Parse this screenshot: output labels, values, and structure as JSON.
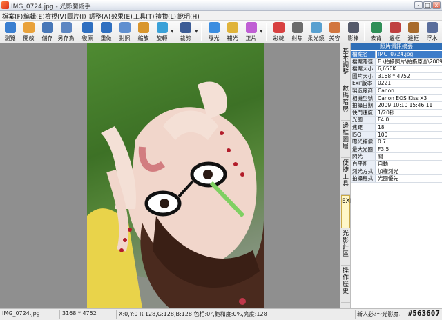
{
  "window": {
    "title": "IMG_0724.jpg - 光影魔術手",
    "minimize": "-",
    "maximize": "□",
    "close": "x"
  },
  "menu": [
    "檔案(F)",
    "編輯(E)",
    "檢視(V)",
    "圖片(I)",
    "調整(A)",
    "效果(E)",
    "工具(T)",
    "禮物(L)",
    "說明(H)"
  ],
  "toolbar": [
    {
      "label": "瀏覽",
      "icon": "browse-icon",
      "color": "#3b7fd0"
    },
    {
      "label": "開啟",
      "icon": "open-folder-icon",
      "color": "#e9a23b"
    },
    {
      "label": "儲存",
      "icon": "save-icon",
      "color": "#4978b8"
    },
    {
      "label": "另存為",
      "icon": "save-as-icon",
      "color": "#5d86c2"
    },
    {
      "label": "復原",
      "icon": "undo-icon",
      "color": "#2f6fc0"
    },
    {
      "label": "重做",
      "icon": "redo-icon",
      "color": "#2f6fc0"
    },
    {
      "label": "對照",
      "icon": "compare-icon",
      "color": "#5f8fd0"
    },
    {
      "label": "縮放",
      "icon": "zoom-icon",
      "color": "#d9962d"
    },
    {
      "label": "旋轉",
      "icon": "rotate-icon",
      "color": "#3aa1d8"
    },
    {
      "label": "裁剪",
      "icon": "crop-icon",
      "color": "#3c5c96"
    },
    {
      "label": "曝光",
      "icon": "exposure-icon",
      "color": "#3b8de0"
    },
    {
      "label": "補光",
      "icon": "fill-light-icon",
      "color": "#e0b33a"
    },
    {
      "label": "正片",
      "icon": "positive-film-icon",
      "color": "#c05fd4"
    },
    {
      "label": "彩縫",
      "icon": "color-icon",
      "color": "#d84141"
    },
    {
      "label": "射焦",
      "icon": "focus-icon",
      "color": "#6c6c6c"
    },
    {
      "label": "柔光鏡",
      "icon": "soft-filter-icon",
      "color": "#58a0d0"
    },
    {
      "label": "美容",
      "icon": "beauty-icon",
      "color": "#d2763f"
    },
    {
      "label": "影棒",
      "icon": "studio-icon",
      "color": "#555a6a"
    },
    {
      "label": "去背",
      "icon": "cutout-icon",
      "color": "#2f8f57"
    },
    {
      "label": "邊框",
      "icon": "border-icon",
      "color": "#c04040"
    },
    {
      "label": "邊框",
      "icon": "frame-icon",
      "color": "#a86b2d"
    },
    {
      "label": "浮水",
      "icon": "watermark-icon",
      "color": "#5a6e9c"
    }
  ],
  "side_tabs": [
    "基本調整",
    "數碼暗房",
    "邊框圖層",
    "便捷工具",
    "EXIF",
    "光影計區",
    "操作歷史"
  ],
  "exif": {
    "header": "照片資訊摘要",
    "rows": [
      {
        "k": "檔案名",
        "v": "IMG_0724.jpg"
      },
      {
        "k": "檔案路徑",
        "v": "E:\\拍攝照片\\拍攝原圖\\200910"
      },
      {
        "k": "檔案大小",
        "v": "6,650K"
      },
      {
        "k": "圖片大小",
        "v": "3168 * 4752"
      },
      {
        "k": "Exif版本",
        "v": "0221"
      },
      {
        "k": "製造廠商",
        "v": "Canon"
      },
      {
        "k": "相機型號",
        "v": "Canon EOS Kiss X3"
      },
      {
        "k": "拍攝日期",
        "v": "2009:10:10 15:46:11"
      },
      {
        "k": "快門速度",
        "v": "1/20秒"
      },
      {
        "k": "光圈",
        "v": "F4.0"
      },
      {
        "k": "焦距",
        "v": "18"
      },
      {
        "k": "ISO",
        "v": "100"
      },
      {
        "k": "曝光補償",
        "v": "0.7"
      },
      {
        "k": "最大光圈",
        "v": "F3.5"
      },
      {
        "k": "閃光",
        "v": "關"
      },
      {
        "k": "白平衡",
        "v": "自動"
      },
      {
        "k": "測光方式",
        "v": "加權測光"
      },
      {
        "k": "拍攝程式",
        "v": "光圈優先"
      }
    ]
  },
  "status": {
    "filename": "IMG_0724.jpg",
    "dimensions": "3168 * 4752",
    "pixel_info": "X:0,Y:0 R:128,G:128,B:128 色相:0°,飽和度:0%,亮度:128",
    "hint": "新人必?～光影魔?手?指南",
    "watermark": "#563607"
  }
}
